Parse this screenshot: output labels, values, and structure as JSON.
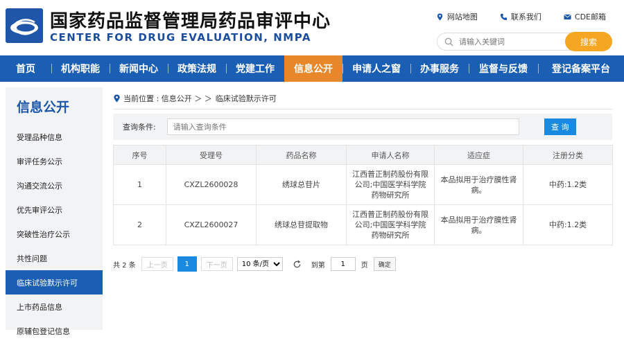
{
  "header": {
    "title_cn": "国家药品监督管理局药品审评中心",
    "title_en": "CENTER FOR DRUG EVALUATION, NMPA",
    "links": [
      {
        "label": "网站地图",
        "icon": "location-pin-icon"
      },
      {
        "label": "联系我们",
        "icon": "phone-icon"
      },
      {
        "label": "CDE邮箱",
        "icon": "mail-icon"
      }
    ],
    "search_placeholder": "请输入关键词",
    "search_button": "搜索"
  },
  "nav": {
    "items": [
      "首页",
      "机构职能",
      "新闻中心",
      "政策法规",
      "党建工作",
      "信息公开",
      "申请人之窗",
      "办事服务",
      "监督与反馈",
      "登记备案平台"
    ],
    "active": "信息公开"
  },
  "sidebar": {
    "title": "信息公开",
    "items": [
      "受理品种信息",
      "审评任务公示",
      "沟通交流公示",
      "优先审评公示",
      "突破性治疗公示",
      "共性问题",
      "临床试验默示许可",
      "上市药品信息",
      "原辅包登记信息"
    ],
    "active": "临床试验默示许可"
  },
  "breadcrumb": {
    "prefix": "当前位置 : 信息公开 ＞ ＞",
    "current": "临床试验默示许可"
  },
  "query": {
    "label": "查询条件:",
    "placeholder": "请输入查询条件",
    "button": "查 询"
  },
  "table": {
    "headers": [
      "序号",
      "受理号",
      "药品名称",
      "申请人名称",
      "适应症",
      "注册分类"
    ],
    "rows": [
      [
        "1",
        "CXZL2600028",
        "绣球总苷片",
        "江西普正制药股份有限公司;中国医学科学院药物研究所",
        "本品拟用于治疗膜性肾病。",
        "中药:1.2类"
      ],
      [
        "2",
        "CXZL2600027",
        "绣球总苷提取物",
        "江西普正制药股份有限公司;中国医学科学院药物研究所",
        "本品拟用于治疗膜性肾病。",
        "中药:1.2类"
      ]
    ]
  },
  "pager": {
    "total": "共 2 条",
    "prev": "上一页",
    "current": "1",
    "next": "下一页",
    "page_size": "10 条/页",
    "goto_label": "到第",
    "goto_value": "1",
    "page_unit": "页",
    "confirm": "确定"
  },
  "colors": {
    "nav_blue": "#1a5fb4",
    "active_orange": "#e8862a",
    "search_orange": "#f5a623",
    "button_blue": "#1a8ae0"
  }
}
